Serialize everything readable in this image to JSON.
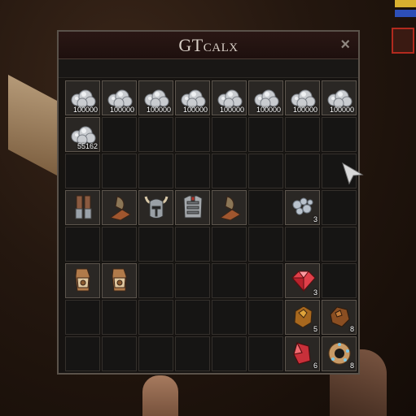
{
  "window": {
    "title": "GTcalx",
    "close_label": "×"
  },
  "hud": {
    "bar_colors": [
      "#d8b030",
      "#2d4fb8"
    ],
    "portrait_border": "#b22a1e"
  },
  "slots": [
    {
      "icon": "silver-ore-icon",
      "qty": "100000"
    },
    {
      "icon": "silver-ore-icon",
      "qty": "100000"
    },
    {
      "icon": "silver-ore-icon",
      "qty": "100000"
    },
    {
      "icon": "silver-ore-icon",
      "qty": "100000"
    },
    {
      "icon": "silver-ore-icon",
      "qty": "100000"
    },
    {
      "icon": "silver-ore-icon",
      "qty": "100000"
    },
    {
      "icon": "silver-ore-icon",
      "qty": "100000"
    },
    {
      "icon": "silver-ore-icon",
      "qty": "100000"
    },
    {
      "icon": "silver-ore-icon",
      "qty": "55162"
    },
    {
      "icon": null,
      "qty": ""
    },
    {
      "icon": null,
      "qty": ""
    },
    {
      "icon": null,
      "qty": ""
    },
    {
      "icon": null,
      "qty": ""
    },
    {
      "icon": null,
      "qty": ""
    },
    {
      "icon": null,
      "qty": ""
    },
    {
      "icon": null,
      "qty": ""
    },
    {
      "icon": null,
      "qty": ""
    },
    {
      "icon": null,
      "qty": ""
    },
    {
      "icon": null,
      "qty": ""
    },
    {
      "icon": null,
      "qty": ""
    },
    {
      "icon": null,
      "qty": ""
    },
    {
      "icon": null,
      "qty": ""
    },
    {
      "icon": null,
      "qty": ""
    },
    {
      "icon": null,
      "qty": ""
    },
    {
      "icon": "leg-armor-icon",
      "qty": ""
    },
    {
      "icon": "arm-guard-icon",
      "qty": ""
    },
    {
      "icon": "horned-helmet-icon",
      "qty": ""
    },
    {
      "icon": "chest-armor-icon",
      "qty": ""
    },
    {
      "icon": "arm-guard-icon",
      "qty": ""
    },
    {
      "icon": null,
      "qty": ""
    },
    {
      "icon": "silver-pebbles-icon",
      "qty": "3"
    },
    {
      "icon": null,
      "qty": ""
    },
    {
      "icon": null,
      "qty": ""
    },
    {
      "icon": null,
      "qty": ""
    },
    {
      "icon": null,
      "qty": ""
    },
    {
      "icon": null,
      "qty": ""
    },
    {
      "icon": null,
      "qty": ""
    },
    {
      "icon": null,
      "qty": ""
    },
    {
      "icon": null,
      "qty": ""
    },
    {
      "icon": null,
      "qty": ""
    },
    {
      "icon": "gauntlet-icon",
      "qty": ""
    },
    {
      "icon": "gauntlet-icon",
      "qty": ""
    },
    {
      "icon": null,
      "qty": ""
    },
    {
      "icon": null,
      "qty": ""
    },
    {
      "icon": null,
      "qty": ""
    },
    {
      "icon": null,
      "qty": ""
    },
    {
      "icon": "red-gem-icon",
      "qty": "3"
    },
    {
      "icon": null,
      "qty": ""
    },
    {
      "icon": null,
      "qty": ""
    },
    {
      "icon": null,
      "qty": ""
    },
    {
      "icon": null,
      "qty": ""
    },
    {
      "icon": null,
      "qty": ""
    },
    {
      "icon": null,
      "qty": ""
    },
    {
      "icon": null,
      "qty": ""
    },
    {
      "icon": "amber-stone-icon",
      "qty": "5"
    },
    {
      "icon": "brown-stone-icon",
      "qty": "8"
    },
    {
      "icon": null,
      "qty": ""
    },
    {
      "icon": null,
      "qty": ""
    },
    {
      "icon": null,
      "qty": ""
    },
    {
      "icon": null,
      "qty": ""
    },
    {
      "icon": null,
      "qty": ""
    },
    {
      "icon": null,
      "qty": ""
    },
    {
      "icon": "ruby-shard-icon",
      "qty": "6"
    },
    {
      "icon": "ring-icon",
      "qty": "8"
    }
  ]
}
